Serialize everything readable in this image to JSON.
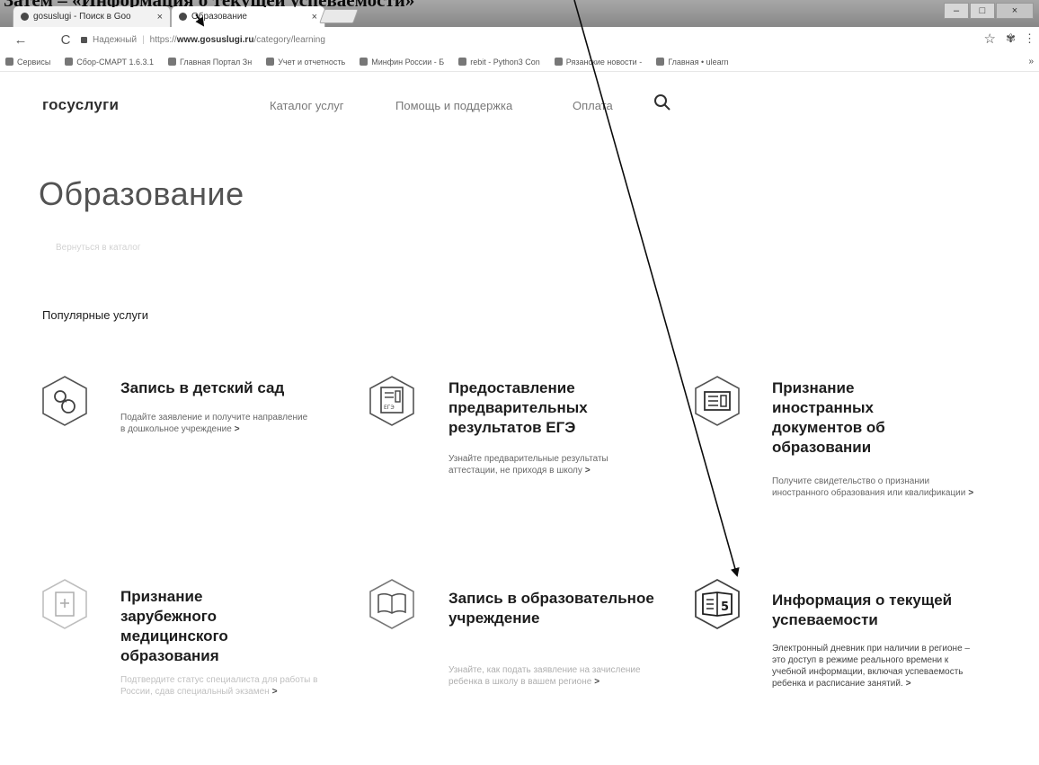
{
  "caption": "Затем – «Информация о текущей успеваемости»",
  "browser": {
    "tabs": [
      {
        "title": "gosuslugi - Поиск в Goo",
        "close": "×"
      },
      {
        "title": "Образование",
        "close": "×"
      }
    ],
    "window_controls": {
      "minimize": "–",
      "maximize": "□",
      "close": "×"
    },
    "nav": {
      "back": "←",
      "reload": "C"
    },
    "address": {
      "security_label": "Надежный",
      "url_scheme": "https://",
      "url_host": "www.gosuslugi.ru",
      "url_path": "/category/learning"
    },
    "bookmarks": [
      "Сервисы",
      "Сбор-СМАРТ 1.6.3.1",
      "Главная Портал Зн",
      "Учет и отчетность",
      "Минфин России - Б",
      "rebit - Python3 Con",
      "Рязанские новости -",
      "Главная • ulearn"
    ],
    "bookmarks_more": "»"
  },
  "site": {
    "logo": "госуслуги",
    "nav": [
      "Каталог услуг",
      "Помощь и поддержка",
      "Оплата"
    ]
  },
  "page": {
    "title": "Образование",
    "back_link": "Вернуться в каталог",
    "section_title": "Популярные услуги"
  },
  "cards": [
    {
      "title": "Запись в детский сад",
      "desc": "Подайте заявление и получите направление в дошкольное учреждение",
      "icon": "pacifier-icon"
    },
    {
      "title": "Предоставление предварительных результатов ЕГЭ",
      "desc": "Узнайте предварительные результаты аттестации, не приходя в школу",
      "icon": "ege-document-icon"
    },
    {
      "title": "Признание иностранных документов об образовании",
      "desc": "Получите свидетельство о признании иностранного образования или квалификации",
      "icon": "diploma-icon"
    },
    {
      "title": "Признание зарубежного медицинского образования",
      "desc": "Подтвердите статус специалиста для работы в России, сдав специальный экзамен",
      "icon": "medical-document-icon"
    },
    {
      "title": "Запись в образовательное учреждение",
      "desc": "Узнайте, как подать заявление на зачисление ребенка в школу в вашем регионе",
      "icon": "book-icon"
    },
    {
      "title": "Информация о текущей успеваемости",
      "desc": "Электронный дневник при наличии в регионе – это доступ в режиме реального времени к учебной информации, включая успеваемость ребенка и расписание занятий.",
      "icon": "gradebook-icon"
    }
  ],
  "chevron": ">"
}
